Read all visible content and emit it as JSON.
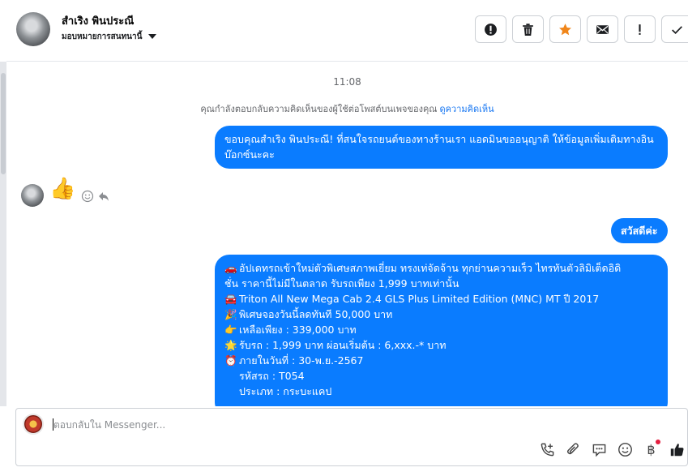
{
  "header": {
    "name": "สำเริง พินประณี",
    "assign_label": "มอบหมายการสนทนานี้",
    "actions": [
      "spam-icon",
      "trash-icon",
      "star-icon",
      "mark-unread-icon",
      "follow-up-icon",
      "done-icon"
    ]
  },
  "chat": {
    "time": "11:08",
    "notice_text": "คุณกำลังตอบกลับความคิดเห็นของผู้ใช้ต่อโพสต์บนเพจของคุณ",
    "notice_link": "ดูความคิดเห็น",
    "msg1": "ขอบคุณสำเริง พินประณี! ที่สนใจรถยนต์ของทางร้านเรา แอดมินขออนุญาติ ให้ข้อมูลเพิ่มเติมทางอินบ๊อกซ์นะคะ",
    "reaction": "👍",
    "msg2": "สวัสดีค่ะ",
    "msg3": {
      "l1": "อัปเดทรถเข้าใหม่ตัวพิเศษสภาพเยี่ยม ทรงเท่จัดจ้าน ทุกย่านความเร็ว ไทรทันตัวลิมิเต็ดอิดิ",
      "l1_icon": "🚗",
      "l2": "ชั่น ราคานี้ไม่มีในตลาด รับรถเพียง 1,999 บาทเท่านั้น",
      "l3": "Triton All New Mega Cab 2.4 GLS Plus Limited Edition (MNC) MT ปี 2017",
      "l3_icon": "🚘",
      "l4": "พิเศษจองวันนี้ลดทันที 50,000 บาท",
      "l4_icon": "🎉",
      "l5": "เหลือเพียง : 339,000 บาท",
      "l5_icon": "👉",
      "l6": "รับรถ : 1,999 บาท ผ่อนเริ่มต้น : 6,xxx.-* บาท",
      "l6_icon": "🌟",
      "l7": "ภายในวันที่ : 30-พ.ย.-2567",
      "l7_icon": "⏰",
      "l8": "รหัสรถ : T054",
      "l9": "ประเภท : กระบะแคป"
    }
  },
  "composer": {
    "placeholder": "ตอบกลับใน Messenger...",
    "tools": [
      "add-call-icon",
      "attach-icon",
      "saved-reply-icon",
      "emoji-icon",
      "baht-icon",
      "like-icon"
    ],
    "baht_symbol": "฿"
  },
  "colors": {
    "brand": "#0a7cff",
    "star": "#f0861a",
    "badge": "#e41e3f"
  }
}
